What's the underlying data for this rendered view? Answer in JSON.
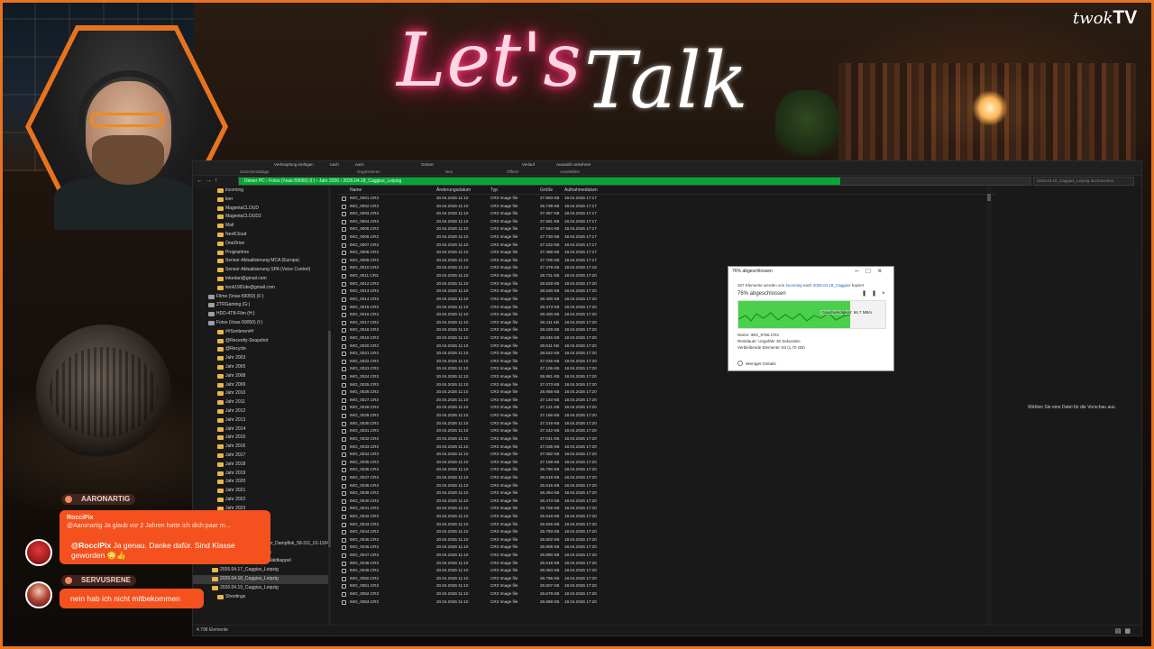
{
  "overlay": {
    "title_part1": "Let's",
    "title_part2": "Talk",
    "brand_prefix": "twok",
    "brand_suffix": "TV",
    "accent_color": "#e8731f",
    "neon_color": "#ff2a6e"
  },
  "explorer": {
    "ribbon": {
      "top": [
        "Verknüpfung einfügen",
        "nach",
        "nach",
        "Ordner",
        "Verlauf",
        "Auswahl umkehren"
      ],
      "groups": [
        "Zwischenablage",
        "Organisieren",
        "Neu",
        "Öffnen",
        "Auswählen"
      ]
    },
    "address": {
      "crumbs": [
        "Dieser PC",
        "Fotos (\\\\nas-59050) (I:)",
        "Jahr 2026",
        "2026.04.18_Caggius_Leipzig"
      ],
      "progress_fraction": 0.76,
      "progress_color": "#06a735"
    },
    "search_placeholder": "2026.04.18_Caggius_Leipzig durchsuchen",
    "sidebar": {
      "items": [
        {
          "label": "incoming",
          "level": 2
        },
        {
          "label": "leer",
          "level": 2
        },
        {
          "label": "MagentaCLOUD",
          "level": 2
        },
        {
          "label": "MagentaCLOUD2",
          "level": 2
        },
        {
          "label": "Mail",
          "level": 2
        },
        {
          "label": "NextCloud",
          "level": 2
        },
        {
          "label": "OneDrive",
          "level": 2
        },
        {
          "label": "Programme",
          "level": 2
        },
        {
          "label": "Sensor-Aktualisierung MCA (Europa)",
          "level": 2
        },
        {
          "label": "Sensor-Aktualisierung SPA (Voice Control)",
          "level": 2
        },
        {
          "label": "tnkedan@gmail.com",
          "level": 2
        },
        {
          "label": "twok1981de@gmail.com",
          "level": 2
        },
        {
          "label": "Filme (\\\\nas-59050) (F:)",
          "level": 1
        },
        {
          "label": "ZTRGaming (G:)",
          "level": 1
        },
        {
          "label": "HDD-4TB-Film (H:)",
          "level": 1
        },
        {
          "label": "Fotos (\\\\nas-59050) (I:)",
          "level": 1
        },
        {
          "label": "##Sortieren##",
          "level": 2
        },
        {
          "label": "@Recently-Snapshot",
          "level": 2
        },
        {
          "label": "@Recycle",
          "level": 2
        },
        {
          "label": "Jahr 2003",
          "level": 2
        },
        {
          "label": "Jahr 2005",
          "level": 2
        },
        {
          "label": "Jahr 2008",
          "level": 2
        },
        {
          "label": "Jahr 2009",
          "level": 2
        },
        {
          "label": "Jahr 2010",
          "level": 2
        },
        {
          "label": "Jahr 2011",
          "level": 2
        },
        {
          "label": "Jahr 2012",
          "level": 2
        },
        {
          "label": "Jahr 2013",
          "level": 2
        },
        {
          "label": "Jahr 2014",
          "level": 2
        },
        {
          "label": "Jahr 2015",
          "level": 2
        },
        {
          "label": "Jahr 2016",
          "level": 2
        },
        {
          "label": "Jahr 2017",
          "level": 2
        },
        {
          "label": "Jahr 2018",
          "level": 2
        },
        {
          "label": "Jahr 2019",
          "level": 2
        },
        {
          "label": "Jahr 2020",
          "level": 2
        },
        {
          "label": "Jahr 2021",
          "level": 2
        },
        {
          "label": "Jahr 2022",
          "level": 2
        },
        {
          "label": "Jahr 2023",
          "level": 2
        },
        {
          "label": "Jahr 2024",
          "level": 2
        },
        {
          "label": "Jahr 2025",
          "level": 2
        },
        {
          "label": "Jahr 2026",
          "level": 2
        },
        {
          "label": "2026.03.14_Bahn_Sonder_Dampflok_58-311_01-1104",
          "level": 3
        },
        {
          "label": "2026.03.21_LBM_Leipzig",
          "level": 3
        },
        {
          "label": "2026.04.03_Osterdoro_Waldkappel",
          "level": 3
        },
        {
          "label": "2026.04.17_Caggius_Leipzig",
          "level": 3
        },
        {
          "label": "2026.04.18_Caggius_Leipzig",
          "level": 3,
          "selected": true
        },
        {
          "label": "2026.04.19_Caggius_Leipzig",
          "level": 3
        },
        {
          "label": "Shootings",
          "level": 2
        }
      ]
    },
    "columns": [
      "Name",
      "Änderungsdatum",
      "Typ",
      "Größe",
      "Aufnahmedatum"
    ],
    "files": [
      [
        "IMG_0001.CR3",
        "20.04.2026 11:10",
        "CR3 Image file",
        "27.893 KB",
        "18.04.2026 17:17"
      ],
      [
        "IMG_0002.CR3",
        "20.04.2026 11:10",
        "CR3 Image file",
        "26.739 KB",
        "18.04.2026 17:17"
      ],
      [
        "IMG_0003.CR3",
        "20.04.2026 11:10",
        "CR3 Image file",
        "27.367 KB",
        "18.04.2026 17:17"
      ],
      [
        "IMG_0004.CR3",
        "20.04.2026 11:10",
        "CR3 Image file",
        "27.581 KB",
        "18.04.2026 17:17"
      ],
      [
        "IMG_0005.CR3",
        "20.04.2026 11:10",
        "CR3 Image file",
        "27.564 KB",
        "18.04.2026 17:17"
      ],
      [
        "IMG_0006.CR3",
        "20.04.2026 11:10",
        "CR3 Image file",
        "27.730 KB",
        "18.04.2026 17:17"
      ],
      [
        "IMG_0007.CR3",
        "20.04.2026 11:10",
        "CR3 Image file",
        "27.222 KB",
        "18.04.2026 17:17"
      ],
      [
        "IMG_0008.CR3",
        "20.04.2026 11:10",
        "CR3 Image file",
        "27.488 KB",
        "18.04.2026 17:17"
      ],
      [
        "IMG_0009.CR3",
        "20.04.2026 11:10",
        "CR3 Image file",
        "27.705 KB",
        "18.04.2026 17:17"
      ],
      [
        "IMG_0010.CR3",
        "20.04.2026 11:10",
        "CR3 Image file",
        "27.378 KB",
        "18.04.2026 17:18"
      ],
      [
        "IMG_0011.CR3",
        "20.04.2026 11:10",
        "CR3 Image file",
        "28.731 KB",
        "18.04.2026 17:20"
      ],
      [
        "IMG_0012.CR3",
        "20.04.2026 11:10",
        "CR3 Image file",
        "28.528 KB",
        "18.04.2026 17:20"
      ],
      [
        "IMG_0013.CR3",
        "20.04.2026 11:10",
        "CR3 Image file",
        "28.530 KB",
        "18.04.2026 17:20"
      ],
      [
        "IMG_0014.CR3",
        "20.04.2026 11:10",
        "CR3 Image file",
        "28.400 KB",
        "18.04.2026 17:20"
      ],
      [
        "IMG_0015.CR3",
        "20.04.2026 11:10",
        "CR3 Image file",
        "28.373 KB",
        "18.04.2026 17:20"
      ],
      [
        "IMG_0016.CR3",
        "20.04.2026 11:10",
        "CR3 Image file",
        "28.400 KB",
        "18.04.2026 17:20"
      ],
      [
        "IMG_0017.CR3",
        "20.04.2026 11:10",
        "CR3 Image file",
        "28.411 KB",
        "18.04.2026 17:20"
      ],
      [
        "IMG_0018.CR3",
        "20.04.2026 11:10",
        "CR3 Image file",
        "28.228 KB",
        "18.04.2026 17:20"
      ],
      [
        "IMG_0019.CR3",
        "20.04.2026 11:10",
        "CR3 Image file",
        "28.645 KB",
        "18.04.2026 17:20"
      ],
      [
        "IMG_0020.CR3",
        "20.04.2026 11:10",
        "CR3 Image file",
        "28.611 KB",
        "18.04.2026 17:20"
      ],
      [
        "IMG_0021.CR3",
        "20.04.2026 11:10",
        "CR3 Image file",
        "28.622 KB",
        "18.04.2026 17:20"
      ],
      [
        "IMG_0022.CR3",
        "20.04.2026 11:10",
        "CR3 Image file",
        "27.025 KB",
        "18.04.2026 17:20"
      ],
      [
        "IMG_0023.CR3",
        "20.04.2026 11:10",
        "CR3 Image file",
        "27.106 KB",
        "18.04.2026 17:20"
      ],
      [
        "IMG_0024.CR3",
        "20.04.2026 11:10",
        "CR3 Image file",
        "26.951 KB",
        "18.04.2026 17:20"
      ],
      [
        "IMG_0025.CR3",
        "20.04.2026 11:10",
        "CR3 Image file",
        "27.073 KB",
        "18.04.2026 17:20"
      ],
      [
        "IMG_0026.CR3",
        "20.04.2026 11:10",
        "CR3 Image file",
        "26.956 KB",
        "18.04.2026 17:20"
      ],
      [
        "IMG_0027.CR3",
        "20.04.2026 11:10",
        "CR3 Image file",
        "27.140 KB",
        "18.04.2026 17:20"
      ],
      [
        "IMG_0028.CR3",
        "20.04.2026 11:10",
        "CR3 Image file",
        "27.121 KB",
        "18.04.2026 17:20"
      ],
      [
        "IMG_0029.CR3",
        "20.04.2026 11:10",
        "CR3 Image file",
        "27.166 KB",
        "18.04.2026 17:20"
      ],
      [
        "IMG_0030.CR3",
        "20.04.2026 11:10",
        "CR3 Image file",
        "27.219 KB",
        "18.04.2026 17:20"
      ],
      [
        "IMG_0031.CR3",
        "20.04.2026 11:10",
        "CR3 Image file",
        "27.242 KB",
        "18.04.2026 17:20"
      ],
      [
        "IMG_0032.CR3",
        "20.04.2026 11:10",
        "CR3 Image file",
        "27.041 KB",
        "18.04.2026 17:20"
      ],
      [
        "IMG_0033.CR3",
        "20.04.2026 11:10",
        "CR3 Image file",
        "27.035 KB",
        "18.04.2026 17:20"
      ],
      [
        "IMG_0034.CR3",
        "20.04.2026 11:10",
        "CR3 Image file",
        "27.082 KB",
        "18.04.2026 17:20"
      ],
      [
        "IMG_0035.CR3",
        "20.04.2026 11:10",
        "CR3 Image file",
        "27.169 KB",
        "18.04.2026 17:20"
      ],
      [
        "IMG_0036.CR3",
        "20.04.2026 11:10",
        "CR3 Image file",
        "26.790 KB",
        "18.04.2026 17:20"
      ],
      [
        "IMG_0037.CR3",
        "20.04.2026 11:10",
        "CR3 Image file",
        "26.619 KB",
        "18.04.2026 17:20"
      ],
      [
        "IMG_0038.CR3",
        "20.04.2026 11:10",
        "CR3 Image file",
        "25.616 KB",
        "18.04.2026 17:20"
      ],
      [
        "IMG_0039.CR3",
        "20.04.2026 11:10",
        "CR3 Image file",
        "26.394 KB",
        "18.04.2026 17:20"
      ],
      [
        "IMG_0040.CR3",
        "20.04.2026 11:10",
        "CR3 Image file",
        "26.473 KB",
        "18.04.2026 17:20"
      ],
      [
        "IMG_0041.CR3",
        "20.04.2026 11:10",
        "CR3 Image file",
        "25.756 KB",
        "18.04.2026 17:20"
      ],
      [
        "IMG_0042.CR3",
        "20.04.2026 11:10",
        "CR3 Image file",
        "25.918 KB",
        "18.04.2026 17:20"
      ],
      [
        "IMG_0043.CR3",
        "20.04.2026 11:10",
        "CR3 Image file",
        "25.926 KB",
        "18.04.2026 17:20"
      ],
      [
        "IMG_0044.CR3",
        "20.04.2026 11:10",
        "CR3 Image file",
        "25.793 KB",
        "18.04.2026 17:20"
      ],
      [
        "IMG_0045.CR3",
        "20.04.2026 11:10",
        "CR3 Image file",
        "25.802 KB",
        "18.04.2026 17:20"
      ],
      [
        "IMG_0046.CR3",
        "20.04.2026 11:10",
        "CR3 Image file",
        "25.808 KB",
        "18.04.2026 17:20"
      ],
      [
        "IMG_0047.CR3",
        "20.04.2026 11:10",
        "CR3 Image file",
        "25.890 KB",
        "18.04.2026 17:20"
      ],
      [
        "IMG_0048.CR3",
        "20.04.2026 11:10",
        "CR3 Image file",
        "25.518 KB",
        "18.04.2026 17:20"
      ],
      [
        "IMG_0049.CR3",
        "20.04.2026 11:10",
        "CR3 Image file",
        "26.083 KB",
        "18.04.2026 17:20"
      ],
      [
        "IMG_0050.CR3",
        "20.04.2026 11:10",
        "CR3 Image file",
        "26.796 KB",
        "18.04.2026 17:20"
      ],
      [
        "IMG_0051.CR3",
        "20.04.2026 11:10",
        "CR3 Image file",
        "26.507 KB",
        "18.04.2026 17:20"
      ],
      [
        "IMG_0052.CR3",
        "20.04.2026 11:10",
        "CR3 Image file",
        "26.679 KB",
        "18.04.2026 17:20"
      ],
      [
        "IMG_0053.CR3",
        "20.04.2026 11:10",
        "CR3 Image file",
        "26.588 KB",
        "18.04.2026 17:20"
      ]
    ],
    "preview_text": "Wählen Sie eine Datei für die Vorschau aus.",
    "status": "4.798 Elemente"
  },
  "copy_dialog": {
    "title": "76% abgeschlossen",
    "info_prefix": "267 Elemente werden von",
    "info_source": "incoming",
    "info_mid": "nach",
    "info_target": "2026.04.18_Caggius",
    "info_suffix": "kopiert",
    "percent_label": "76% abgeschlossen",
    "progress_fraction": 0.76,
    "speed": "Geschwindigkeit: 66,7 MB/s",
    "name_line": "Name: IMG_9766.CR3",
    "remaining_line": "Restdauer: Ungefähr 30 Sekunden",
    "items_line": "Verbleibende Elemente: 63 (1,70 GB)",
    "details_label": "Weniger Details"
  },
  "chat": {
    "messages": [
      {
        "user": "AARONARTIG",
        "reply_to_user": "RocciPix",
        "reply_to_text": "@Aaronartig Ja glaub vor 2 Jahren hatte ich dich paar m...",
        "mention": "@RocciPix",
        "text": "Ja genau. Danke dafür. Sind Klasse geworden 😳👍"
      },
      {
        "user": "SERVUSRENE",
        "text": "nein hab ich nicht mitbekommen"
      }
    ]
  }
}
